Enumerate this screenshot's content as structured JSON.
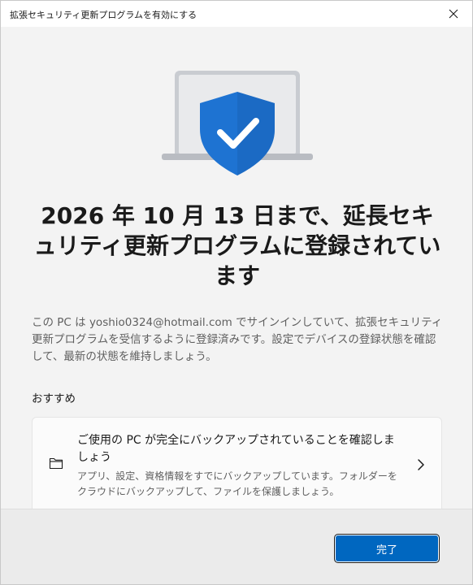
{
  "window": {
    "title": "拡張セキュリティ更新プログラムを有効にする"
  },
  "main": {
    "heading": "2026 年 10 月 13 日まで、延長セキュリティ更新プログラムに登録されています",
    "description": "この PC は yoshio0324@hotmail.com でサインインしていて、拡張セキュリティ更新プログラムを受信するように登録済みです。設定でデバイスの登録状態を確認して、最新の状態を維持しましょう。",
    "recommended_label": "おすすめ",
    "card": {
      "icon": "folder-icon",
      "title": "ご使用の PC が完全にバックアップされていることを確認しましょう",
      "description": "アプリ、設定、資格情報をすでにバックアップしています。フォルダーをクラウドにバックアップして、ファイルを保護しましょう。"
    }
  },
  "footer": {
    "done_label": "完了"
  },
  "colors": {
    "accent": "#0067c0",
    "shield": "#1e73d2"
  }
}
